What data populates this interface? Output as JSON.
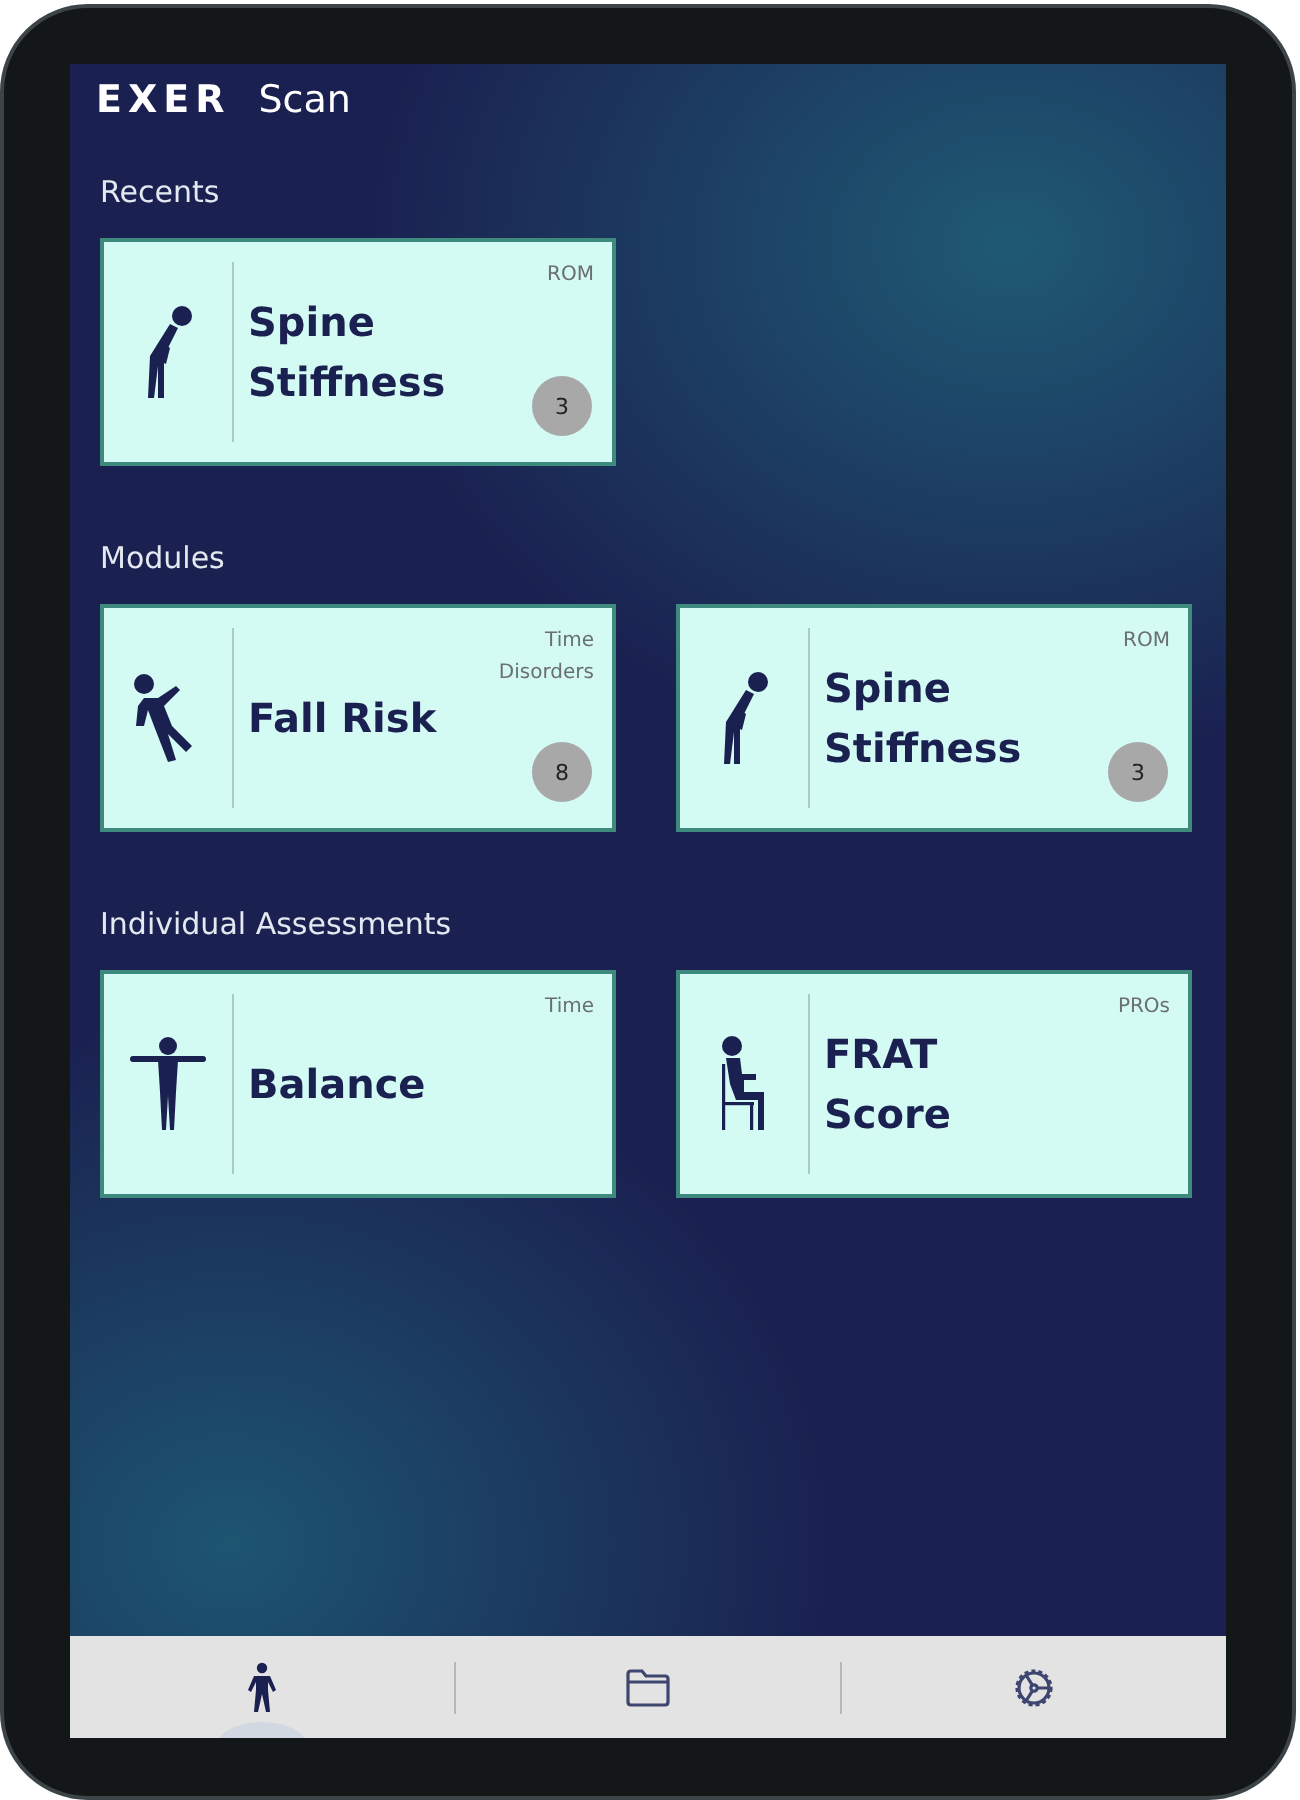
{
  "header": {
    "logo": "EXER",
    "title": "Scan"
  },
  "sections": [
    {
      "title": "Recents",
      "cards": [
        {
          "kind": "stooping",
          "title": [
            "Spine",
            "Stiffness"
          ],
          "tags": [
            "ROM"
          ],
          "count": "3"
        }
      ]
    },
    {
      "title": "Modules",
      "cards": [
        {
          "kind": "falling",
          "title": [
            "Fall Risk"
          ],
          "tags": [
            "Time",
            "Disorders"
          ],
          "count": "8"
        },
        {
          "kind": "stooping",
          "title": [
            "Spine",
            "Stiffness"
          ],
          "tags": [
            "ROM"
          ],
          "count": "3"
        }
      ]
    },
    {
      "title": "Individual Assessments",
      "cards": [
        {
          "kind": "tpose",
          "title": [
            "Balance"
          ],
          "tags": [
            "Time"
          ]
        },
        {
          "kind": "seated",
          "title": [
            "FRAT",
            "Score"
          ],
          "tags": [
            "PROs"
          ]
        }
      ]
    }
  ],
  "nav": [
    {
      "kind": "person",
      "selected": true
    },
    {
      "kind": "folder",
      "selected": false
    },
    {
      "kind": "settings",
      "selected": false
    }
  ]
}
